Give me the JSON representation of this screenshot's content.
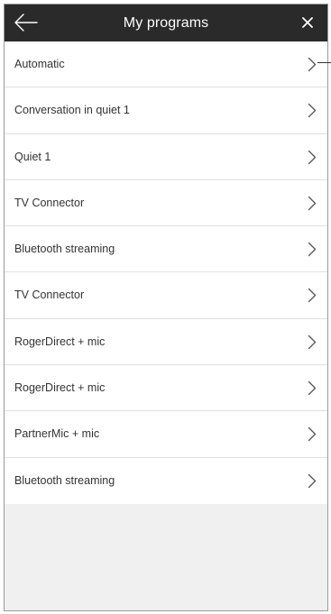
{
  "header": {
    "title": "My programs",
    "back_icon": "arrow-left-icon",
    "close_icon": "close-icon",
    "background": "#2a2a2a"
  },
  "programs": [
    {
      "label": "Automatic"
    },
    {
      "label": "Conversation in quiet 1"
    },
    {
      "label": "Quiet 1"
    },
    {
      "label": "TV Connector"
    },
    {
      "label": "Bluetooth streaming"
    },
    {
      "label": "TV Connector"
    },
    {
      "label": "RogerDirect + mic"
    },
    {
      "label": "RogerDirect + mic"
    },
    {
      "label": "PartnerMic + mic"
    },
    {
      "label": "Bluetooth streaming"
    }
  ],
  "item_icon": "chevron-right-icon"
}
